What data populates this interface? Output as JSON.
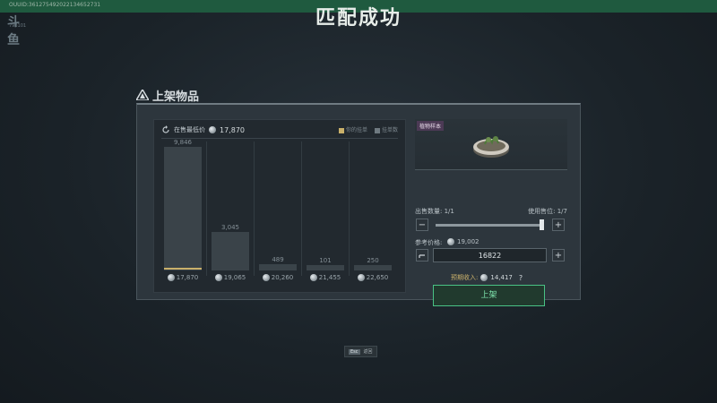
{
  "top_bar": {
    "session_id": "OUUID:361275492022134652731"
  },
  "banner": {
    "title": "匹配成功"
  },
  "logo": {
    "text": "斗鱼",
    "sub": "793101"
  },
  "panel": {
    "title": "上架物品"
  },
  "chart": {
    "lowest_label": "在售最低价",
    "lowest_price": "17,870",
    "legend_mine": "你的挂单",
    "legend_other": "挂单数"
  },
  "chart_data": {
    "type": "bar",
    "categories": [
      "17,870",
      "19,065",
      "20,260",
      "21,455",
      "22,650"
    ],
    "values": [
      9846,
      3045,
      489,
      101,
      250
    ],
    "value_labels": [
      "9,846",
      "3,045",
      "489",
      "101",
      "250"
    ],
    "series": [
      {
        "name": "挂单数",
        "values": [
          9846,
          3045,
          489,
          101,
          250
        ]
      }
    ],
    "ylim": [
      0,
      10000
    ]
  },
  "item": {
    "tag": "植物样本"
  },
  "sale": {
    "qty_label": "出售数量: 1/1",
    "slots_label": "使用售位: 1/7",
    "ref_label": "参考价格:",
    "ref_price": "19,002",
    "price_value": "16822",
    "income_label": "预期收入:",
    "income_value": "14,417",
    "help": "?",
    "list_button": "上架",
    "minus": "−",
    "plus": "+",
    "quantity_fraction": 1.0
  },
  "footer": {
    "esc_key": "Esc",
    "esc_label": "返回"
  },
  "colors": {
    "accent_green": "#49c285",
    "mine_gold": "#c9b06a",
    "banner_green": "#1f5a3f"
  }
}
